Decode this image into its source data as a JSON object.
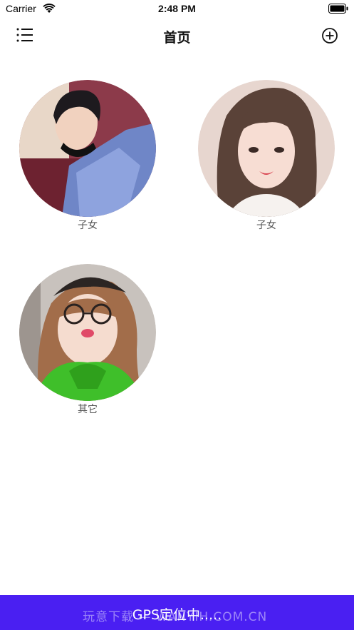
{
  "status_bar": {
    "carrier": "Carrier",
    "time": "2:48 PM"
  },
  "nav": {
    "title": "首页",
    "menu_icon": "list-menu-icon",
    "add_icon": "plus-circle-icon"
  },
  "categories": [
    {
      "label": "子女",
      "avatar": "photo-young-man"
    },
    {
      "label": "子女",
      "avatar": "photo-young-woman"
    },
    {
      "label": "其它",
      "avatar": "photo-girl-glasses"
    }
  ],
  "footer": {
    "status": "GPS定位中.....",
    "watermark": "玩意下载 — WANYIH.COM.CN",
    "background": "#4a1ff2"
  }
}
